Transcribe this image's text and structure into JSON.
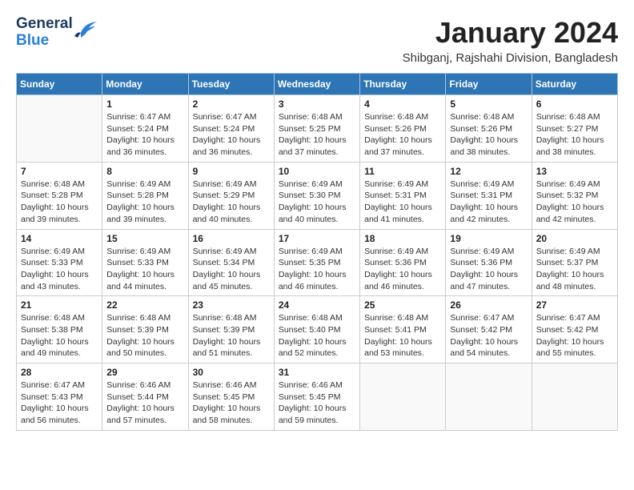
{
  "header": {
    "logo_general": "General",
    "logo_blue": "Blue",
    "month_title": "January 2024",
    "location": "Shibganj, Rajshahi Division, Bangladesh"
  },
  "weekdays": [
    "Sunday",
    "Monday",
    "Tuesday",
    "Wednesday",
    "Thursday",
    "Friday",
    "Saturday"
  ],
  "weeks": [
    [
      {
        "day": "",
        "sunrise": "",
        "sunset": "",
        "daylight": ""
      },
      {
        "day": "1",
        "sunrise": "Sunrise: 6:47 AM",
        "sunset": "Sunset: 5:24 PM",
        "daylight": "Daylight: 10 hours and 36 minutes."
      },
      {
        "day": "2",
        "sunrise": "Sunrise: 6:47 AM",
        "sunset": "Sunset: 5:24 PM",
        "daylight": "Daylight: 10 hours and 36 minutes."
      },
      {
        "day": "3",
        "sunrise": "Sunrise: 6:48 AM",
        "sunset": "Sunset: 5:25 PM",
        "daylight": "Daylight: 10 hours and 37 minutes."
      },
      {
        "day": "4",
        "sunrise": "Sunrise: 6:48 AM",
        "sunset": "Sunset: 5:26 PM",
        "daylight": "Daylight: 10 hours and 37 minutes."
      },
      {
        "day": "5",
        "sunrise": "Sunrise: 6:48 AM",
        "sunset": "Sunset: 5:26 PM",
        "daylight": "Daylight: 10 hours and 38 minutes."
      },
      {
        "day": "6",
        "sunrise": "Sunrise: 6:48 AM",
        "sunset": "Sunset: 5:27 PM",
        "daylight": "Daylight: 10 hours and 38 minutes."
      }
    ],
    [
      {
        "day": "7",
        "sunrise": "Sunrise: 6:48 AM",
        "sunset": "Sunset: 5:28 PM",
        "daylight": "Daylight: 10 hours and 39 minutes."
      },
      {
        "day": "8",
        "sunrise": "Sunrise: 6:49 AM",
        "sunset": "Sunset: 5:28 PM",
        "daylight": "Daylight: 10 hours and 39 minutes."
      },
      {
        "day": "9",
        "sunrise": "Sunrise: 6:49 AM",
        "sunset": "Sunset: 5:29 PM",
        "daylight": "Daylight: 10 hours and 40 minutes."
      },
      {
        "day": "10",
        "sunrise": "Sunrise: 6:49 AM",
        "sunset": "Sunset: 5:30 PM",
        "daylight": "Daylight: 10 hours and 40 minutes."
      },
      {
        "day": "11",
        "sunrise": "Sunrise: 6:49 AM",
        "sunset": "Sunset: 5:31 PM",
        "daylight": "Daylight: 10 hours and 41 minutes."
      },
      {
        "day": "12",
        "sunrise": "Sunrise: 6:49 AM",
        "sunset": "Sunset: 5:31 PM",
        "daylight": "Daylight: 10 hours and 42 minutes."
      },
      {
        "day": "13",
        "sunrise": "Sunrise: 6:49 AM",
        "sunset": "Sunset: 5:32 PM",
        "daylight": "Daylight: 10 hours and 42 minutes."
      }
    ],
    [
      {
        "day": "14",
        "sunrise": "Sunrise: 6:49 AM",
        "sunset": "Sunset: 5:33 PM",
        "daylight": "Daylight: 10 hours and 43 minutes."
      },
      {
        "day": "15",
        "sunrise": "Sunrise: 6:49 AM",
        "sunset": "Sunset: 5:33 PM",
        "daylight": "Daylight: 10 hours and 44 minutes."
      },
      {
        "day": "16",
        "sunrise": "Sunrise: 6:49 AM",
        "sunset": "Sunset: 5:34 PM",
        "daylight": "Daylight: 10 hours and 45 minutes."
      },
      {
        "day": "17",
        "sunrise": "Sunrise: 6:49 AM",
        "sunset": "Sunset: 5:35 PM",
        "daylight": "Daylight: 10 hours and 46 minutes."
      },
      {
        "day": "18",
        "sunrise": "Sunrise: 6:49 AM",
        "sunset": "Sunset: 5:36 PM",
        "daylight": "Daylight: 10 hours and 46 minutes."
      },
      {
        "day": "19",
        "sunrise": "Sunrise: 6:49 AM",
        "sunset": "Sunset: 5:36 PM",
        "daylight": "Daylight: 10 hours and 47 minutes."
      },
      {
        "day": "20",
        "sunrise": "Sunrise: 6:49 AM",
        "sunset": "Sunset: 5:37 PM",
        "daylight": "Daylight: 10 hours and 48 minutes."
      }
    ],
    [
      {
        "day": "21",
        "sunrise": "Sunrise: 6:48 AM",
        "sunset": "Sunset: 5:38 PM",
        "daylight": "Daylight: 10 hours and 49 minutes."
      },
      {
        "day": "22",
        "sunrise": "Sunrise: 6:48 AM",
        "sunset": "Sunset: 5:39 PM",
        "daylight": "Daylight: 10 hours and 50 minutes."
      },
      {
        "day": "23",
        "sunrise": "Sunrise: 6:48 AM",
        "sunset": "Sunset: 5:39 PM",
        "daylight": "Daylight: 10 hours and 51 minutes."
      },
      {
        "day": "24",
        "sunrise": "Sunrise: 6:48 AM",
        "sunset": "Sunset: 5:40 PM",
        "daylight": "Daylight: 10 hours and 52 minutes."
      },
      {
        "day": "25",
        "sunrise": "Sunrise: 6:48 AM",
        "sunset": "Sunset: 5:41 PM",
        "daylight": "Daylight: 10 hours and 53 minutes."
      },
      {
        "day": "26",
        "sunrise": "Sunrise: 6:47 AM",
        "sunset": "Sunset: 5:42 PM",
        "daylight": "Daylight: 10 hours and 54 minutes."
      },
      {
        "day": "27",
        "sunrise": "Sunrise: 6:47 AM",
        "sunset": "Sunset: 5:42 PM",
        "daylight": "Daylight: 10 hours and 55 minutes."
      }
    ],
    [
      {
        "day": "28",
        "sunrise": "Sunrise: 6:47 AM",
        "sunset": "Sunset: 5:43 PM",
        "daylight": "Daylight: 10 hours and 56 minutes."
      },
      {
        "day": "29",
        "sunrise": "Sunrise: 6:46 AM",
        "sunset": "Sunset: 5:44 PM",
        "daylight": "Daylight: 10 hours and 57 minutes."
      },
      {
        "day": "30",
        "sunrise": "Sunrise: 6:46 AM",
        "sunset": "Sunset: 5:45 PM",
        "daylight": "Daylight: 10 hours and 58 minutes."
      },
      {
        "day": "31",
        "sunrise": "Sunrise: 6:46 AM",
        "sunset": "Sunset: 5:45 PM",
        "daylight": "Daylight: 10 hours and 59 minutes."
      },
      {
        "day": "",
        "sunrise": "",
        "sunset": "",
        "daylight": ""
      },
      {
        "day": "",
        "sunrise": "",
        "sunset": "",
        "daylight": ""
      },
      {
        "day": "",
        "sunrise": "",
        "sunset": "",
        "daylight": ""
      }
    ]
  ]
}
